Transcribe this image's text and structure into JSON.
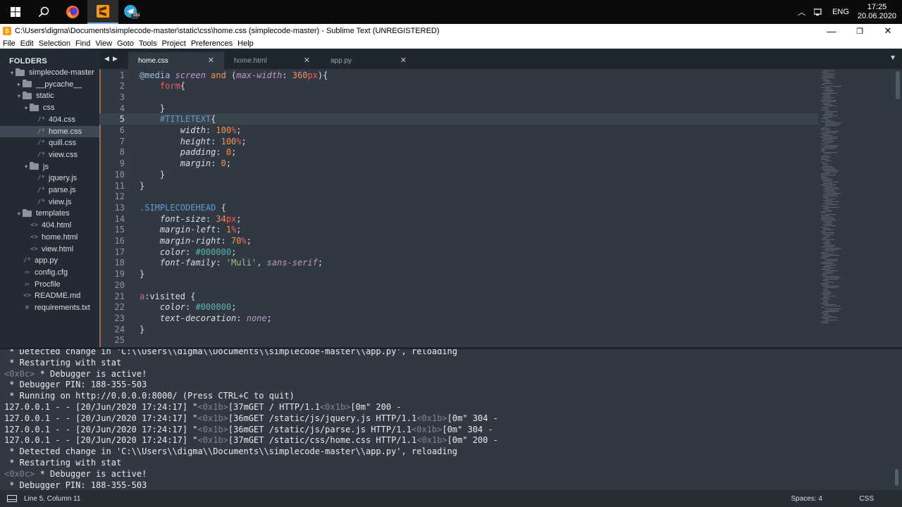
{
  "taskbar": {
    "icons": [
      "windows-icon",
      "search-icon",
      "firefox-icon",
      "sublime-text-icon",
      "telegram-icon"
    ],
    "telegram_badge": "581",
    "language": "ENG",
    "time": "17:25",
    "date": "20.06.2020"
  },
  "window": {
    "title": "C:\\Users\\digma\\Documents\\simplecode-master\\static\\css\\home.css (simplecode-master) - Sublime Text (UNREGISTERED)"
  },
  "menu": [
    "File",
    "Edit",
    "Selection",
    "Find",
    "View",
    "Goto",
    "Tools",
    "Project",
    "Preferences",
    "Help"
  ],
  "sidebar": {
    "header": "FOLDERS",
    "items": [
      {
        "label": "simplecode-master",
        "kind": "folder-open",
        "arrow": "▾"
      },
      {
        "label": "__pycache__",
        "kind": "folder",
        "arrow": "▸"
      },
      {
        "label": "static",
        "kind": "folder-open",
        "arrow": "▾"
      },
      {
        "label": "css",
        "kind": "folder-open",
        "arrow": "▾"
      },
      {
        "label": "404.css",
        "kind": "file",
        "glyph": "/*"
      },
      {
        "label": "home.css",
        "kind": "file",
        "glyph": "/*",
        "selected": true
      },
      {
        "label": "quill.css",
        "kind": "file",
        "glyph": "/*"
      },
      {
        "label": "view.css",
        "kind": "file",
        "glyph": "/*"
      },
      {
        "label": "js",
        "kind": "folder-open",
        "arrow": "▾"
      },
      {
        "label": "jquery.js",
        "kind": "file",
        "glyph": "/*"
      },
      {
        "label": "parse.js",
        "kind": "file",
        "glyph": "/*"
      },
      {
        "label": "view.js",
        "kind": "file",
        "glyph": "/*"
      },
      {
        "label": "templates",
        "kind": "folder-open",
        "arrow": "▾"
      },
      {
        "label": "404.html",
        "kind": "file",
        "glyph": "<>"
      },
      {
        "label": "home.html",
        "kind": "file",
        "glyph": "<>"
      },
      {
        "label": "view.html",
        "kind": "file",
        "glyph": "<>"
      },
      {
        "label": "app.py",
        "kind": "file",
        "glyph": "/*"
      },
      {
        "label": "config.cfg",
        "kind": "file",
        "glyph": "▭"
      },
      {
        "label": "Procfile",
        "kind": "file",
        "glyph": "▭"
      },
      {
        "label": "README.md",
        "kind": "file",
        "glyph": "<>"
      },
      {
        "label": "requirements.txt",
        "kind": "file",
        "glyph": "≡"
      }
    ]
  },
  "tabs": [
    {
      "label": "home.css",
      "active": true
    },
    {
      "label": "home.html",
      "active": false
    },
    {
      "label": "app.py",
      "active": false
    }
  ],
  "editor": {
    "current_line": 5,
    "lines": [
      {
        "n": "1",
        "segs": [
          [
            "@media ",
            "#9fbfdd"
          ],
          [
            "screen",
            "#c594c5",
            "italic"
          ],
          [
            " and ",
            "#f99157"
          ],
          [
            "(",
            "#d8dee9"
          ],
          [
            "max-width",
            "#c594c5",
            "italic"
          ],
          [
            ": ",
            "#d8dee9"
          ],
          [
            "360",
            "#f99157"
          ],
          [
            "px",
            "#ec5f66"
          ],
          [
            "){",
            "#d8dee9"
          ]
        ]
      },
      {
        "n": "2",
        "segs": [
          [
            "    form",
            "#ec5f66"
          ],
          [
            "{",
            "#d8dee9"
          ]
        ]
      },
      {
        "n": "3",
        "segs": []
      },
      {
        "n": "4",
        "segs": [
          [
            "    }",
            "#d8dee9"
          ]
        ]
      },
      {
        "n": "5",
        "segs": [
          [
            "    #TITLETEXT",
            "#6699cc"
          ],
          [
            "{",
            "#d8dee9"
          ]
        ]
      },
      {
        "n": "6",
        "segs": [
          [
            "        width",
            "#d8dee9",
            "italic"
          ],
          [
            ": ",
            "#d8dee9"
          ],
          [
            "100",
            "#f99157"
          ],
          [
            "%",
            "#ec5f66"
          ],
          [
            ";",
            "#d8dee9"
          ]
        ]
      },
      {
        "n": "7",
        "segs": [
          [
            "        height",
            "#d8dee9",
            "italic"
          ],
          [
            ": ",
            "#d8dee9"
          ],
          [
            "100",
            "#f99157"
          ],
          [
            "%",
            "#ec5f66"
          ],
          [
            ";",
            "#d8dee9"
          ]
        ]
      },
      {
        "n": "8",
        "segs": [
          [
            "        padding",
            "#d8dee9",
            "italic"
          ],
          [
            ": ",
            "#d8dee9"
          ],
          [
            "0",
            "#f99157"
          ],
          [
            ";",
            "#d8dee9"
          ]
        ]
      },
      {
        "n": "9",
        "segs": [
          [
            "        margin",
            "#d8dee9",
            "italic"
          ],
          [
            ": ",
            "#d8dee9"
          ],
          [
            "0",
            "#f99157"
          ],
          [
            ";",
            "#d8dee9"
          ]
        ]
      },
      {
        "n": "10",
        "segs": [
          [
            "    }",
            "#d8dee9"
          ]
        ]
      },
      {
        "n": "11",
        "segs": [
          [
            "}",
            "#d8dee9"
          ]
        ]
      },
      {
        "n": "12",
        "segs": []
      },
      {
        "n": "13",
        "segs": [
          [
            ".SIMPLECODEHEAD",
            "#6699cc"
          ],
          [
            " {",
            "#d8dee9"
          ]
        ]
      },
      {
        "n": "14",
        "segs": [
          [
            "    font-size",
            "#d8dee9",
            "italic"
          ],
          [
            ": ",
            "#d8dee9"
          ],
          [
            "34",
            "#f99157"
          ],
          [
            "px",
            "#ec5f66"
          ],
          [
            ";",
            "#d8dee9"
          ]
        ]
      },
      {
        "n": "15",
        "segs": [
          [
            "    margin-left",
            "#d8dee9",
            "italic"
          ],
          [
            ": ",
            "#d8dee9"
          ],
          [
            "1",
            "#f99157"
          ],
          [
            "%",
            "#ec5f66"
          ],
          [
            ";",
            "#d8dee9"
          ]
        ]
      },
      {
        "n": "16",
        "segs": [
          [
            "    margin-right",
            "#d8dee9",
            "italic"
          ],
          [
            ": ",
            "#d8dee9"
          ],
          [
            "70",
            "#f99157"
          ],
          [
            "%",
            "#ec5f66"
          ],
          [
            ";",
            "#d8dee9"
          ]
        ]
      },
      {
        "n": "17",
        "segs": [
          [
            "    color",
            "#d8dee9",
            "italic"
          ],
          [
            ": ",
            "#d8dee9"
          ],
          [
            "#000000",
            "#5fb3b3"
          ],
          [
            ";",
            "#d8dee9"
          ]
        ]
      },
      {
        "n": "18",
        "segs": [
          [
            "    font-family",
            "#d8dee9",
            "italic"
          ],
          [
            ": ",
            "#d8dee9"
          ],
          [
            "'Muli'",
            "#99c794"
          ],
          [
            ", ",
            "#d8dee9"
          ],
          [
            "sans-serif",
            "#c594c5",
            "italic"
          ],
          [
            ";",
            "#d8dee9"
          ]
        ]
      },
      {
        "n": "19",
        "segs": [
          [
            "}",
            "#d8dee9"
          ]
        ]
      },
      {
        "n": "20",
        "segs": []
      },
      {
        "n": "21",
        "segs": [
          [
            "a",
            "#ec5f66"
          ],
          [
            ":visited",
            "#d8dee9"
          ],
          [
            " {",
            "#d8dee9"
          ]
        ]
      },
      {
        "n": "22",
        "segs": [
          [
            "    color",
            "#d8dee9",
            "italic"
          ],
          [
            ": ",
            "#d8dee9"
          ],
          [
            "#000000",
            "#5fb3b3"
          ],
          [
            ";",
            "#d8dee9"
          ]
        ]
      },
      {
        "n": "23",
        "segs": [
          [
            "    text-decoration",
            "#d8dee9",
            "italic"
          ],
          [
            ": ",
            "#d8dee9"
          ],
          [
            "none",
            "#c594c5",
            "italic"
          ],
          [
            ";",
            "#d8dee9"
          ]
        ]
      },
      {
        "n": "24",
        "segs": [
          [
            "}",
            "#d8dee9"
          ]
        ]
      },
      {
        "n": "25",
        "segs": []
      }
    ]
  },
  "console": {
    "lines": [
      [
        [
          " * Detected change in 'C:\\\\Users\\\\digma\\\\Documents\\\\simplecode-master\\\\app.py', reloading",
          "#e8ecef"
        ]
      ],
      [
        [
          " * Restarting with stat",
          "#e8ecef"
        ]
      ],
      [
        [
          "<0x0c>",
          "#7b8590"
        ],
        [
          " * Debugger is active!",
          "#e8ecef"
        ]
      ],
      [
        [
          " * Debugger PIN: 188-355-503",
          "#e8ecef"
        ]
      ],
      [
        [
          " * Running on http://0.0.0.0:8000/ (Press CTRL+C to quit)",
          "#e8ecef"
        ]
      ],
      [
        [
          "127.0.0.1 - - [20/Jun/2020 17:24:17] \"",
          "#e8ecef"
        ],
        [
          "<0x1b>",
          "#7b8590"
        ],
        [
          "[37mGET / HTTP/1.1",
          "#e8ecef"
        ],
        [
          "<0x1b>",
          "#7b8590"
        ],
        [
          "[0m\" 200 -",
          "#e8ecef"
        ]
      ],
      [
        [
          "127.0.0.1 - - [20/Jun/2020 17:24:17] \"",
          "#e8ecef"
        ],
        [
          "<0x1b>",
          "#7b8590"
        ],
        [
          "[36mGET /static/js/jquery.js HTTP/1.1",
          "#e8ecef"
        ],
        [
          "<0x1b>",
          "#7b8590"
        ],
        [
          "[0m\" 304 -",
          "#e8ecef"
        ]
      ],
      [
        [
          "127.0.0.1 - - [20/Jun/2020 17:24:17] \"",
          "#e8ecef"
        ],
        [
          "<0x1b>",
          "#7b8590"
        ],
        [
          "[36mGET /static/js/parse.js HTTP/1.1",
          "#e8ecef"
        ],
        [
          "<0x1b>",
          "#7b8590"
        ],
        [
          "[0m\" 304 -",
          "#e8ecef"
        ]
      ],
      [
        [
          "127.0.0.1 - - [20/Jun/2020 17:24:17] \"",
          "#e8ecef"
        ],
        [
          "<0x1b>",
          "#7b8590"
        ],
        [
          "[37mGET /static/css/home.css HTTP/1.1",
          "#e8ecef"
        ],
        [
          "<0x1b>",
          "#7b8590"
        ],
        [
          "[0m\" 200 -",
          "#e8ecef"
        ]
      ],
      [
        [
          " * Detected change in 'C:\\\\Users\\\\digma\\\\Documents\\\\simplecode-master\\\\app.py', reloading",
          "#e8ecef"
        ]
      ],
      [
        [
          " * Restarting with stat",
          "#e8ecef"
        ]
      ],
      [
        [
          "<0x0c>",
          "#7b8590"
        ],
        [
          " * Debugger is active!",
          "#e8ecef"
        ]
      ],
      [
        [
          " * Debugger PIN: 188-355-503",
          "#e8ecef"
        ]
      ]
    ]
  },
  "status": {
    "position": "Line 5, Column 11",
    "spaces": "Spaces: 4",
    "syntax": "CSS"
  },
  "colors": {
    "editor_bg": "#303841",
    "sidebar_bg": "#222b33",
    "accent": "#f99157"
  }
}
